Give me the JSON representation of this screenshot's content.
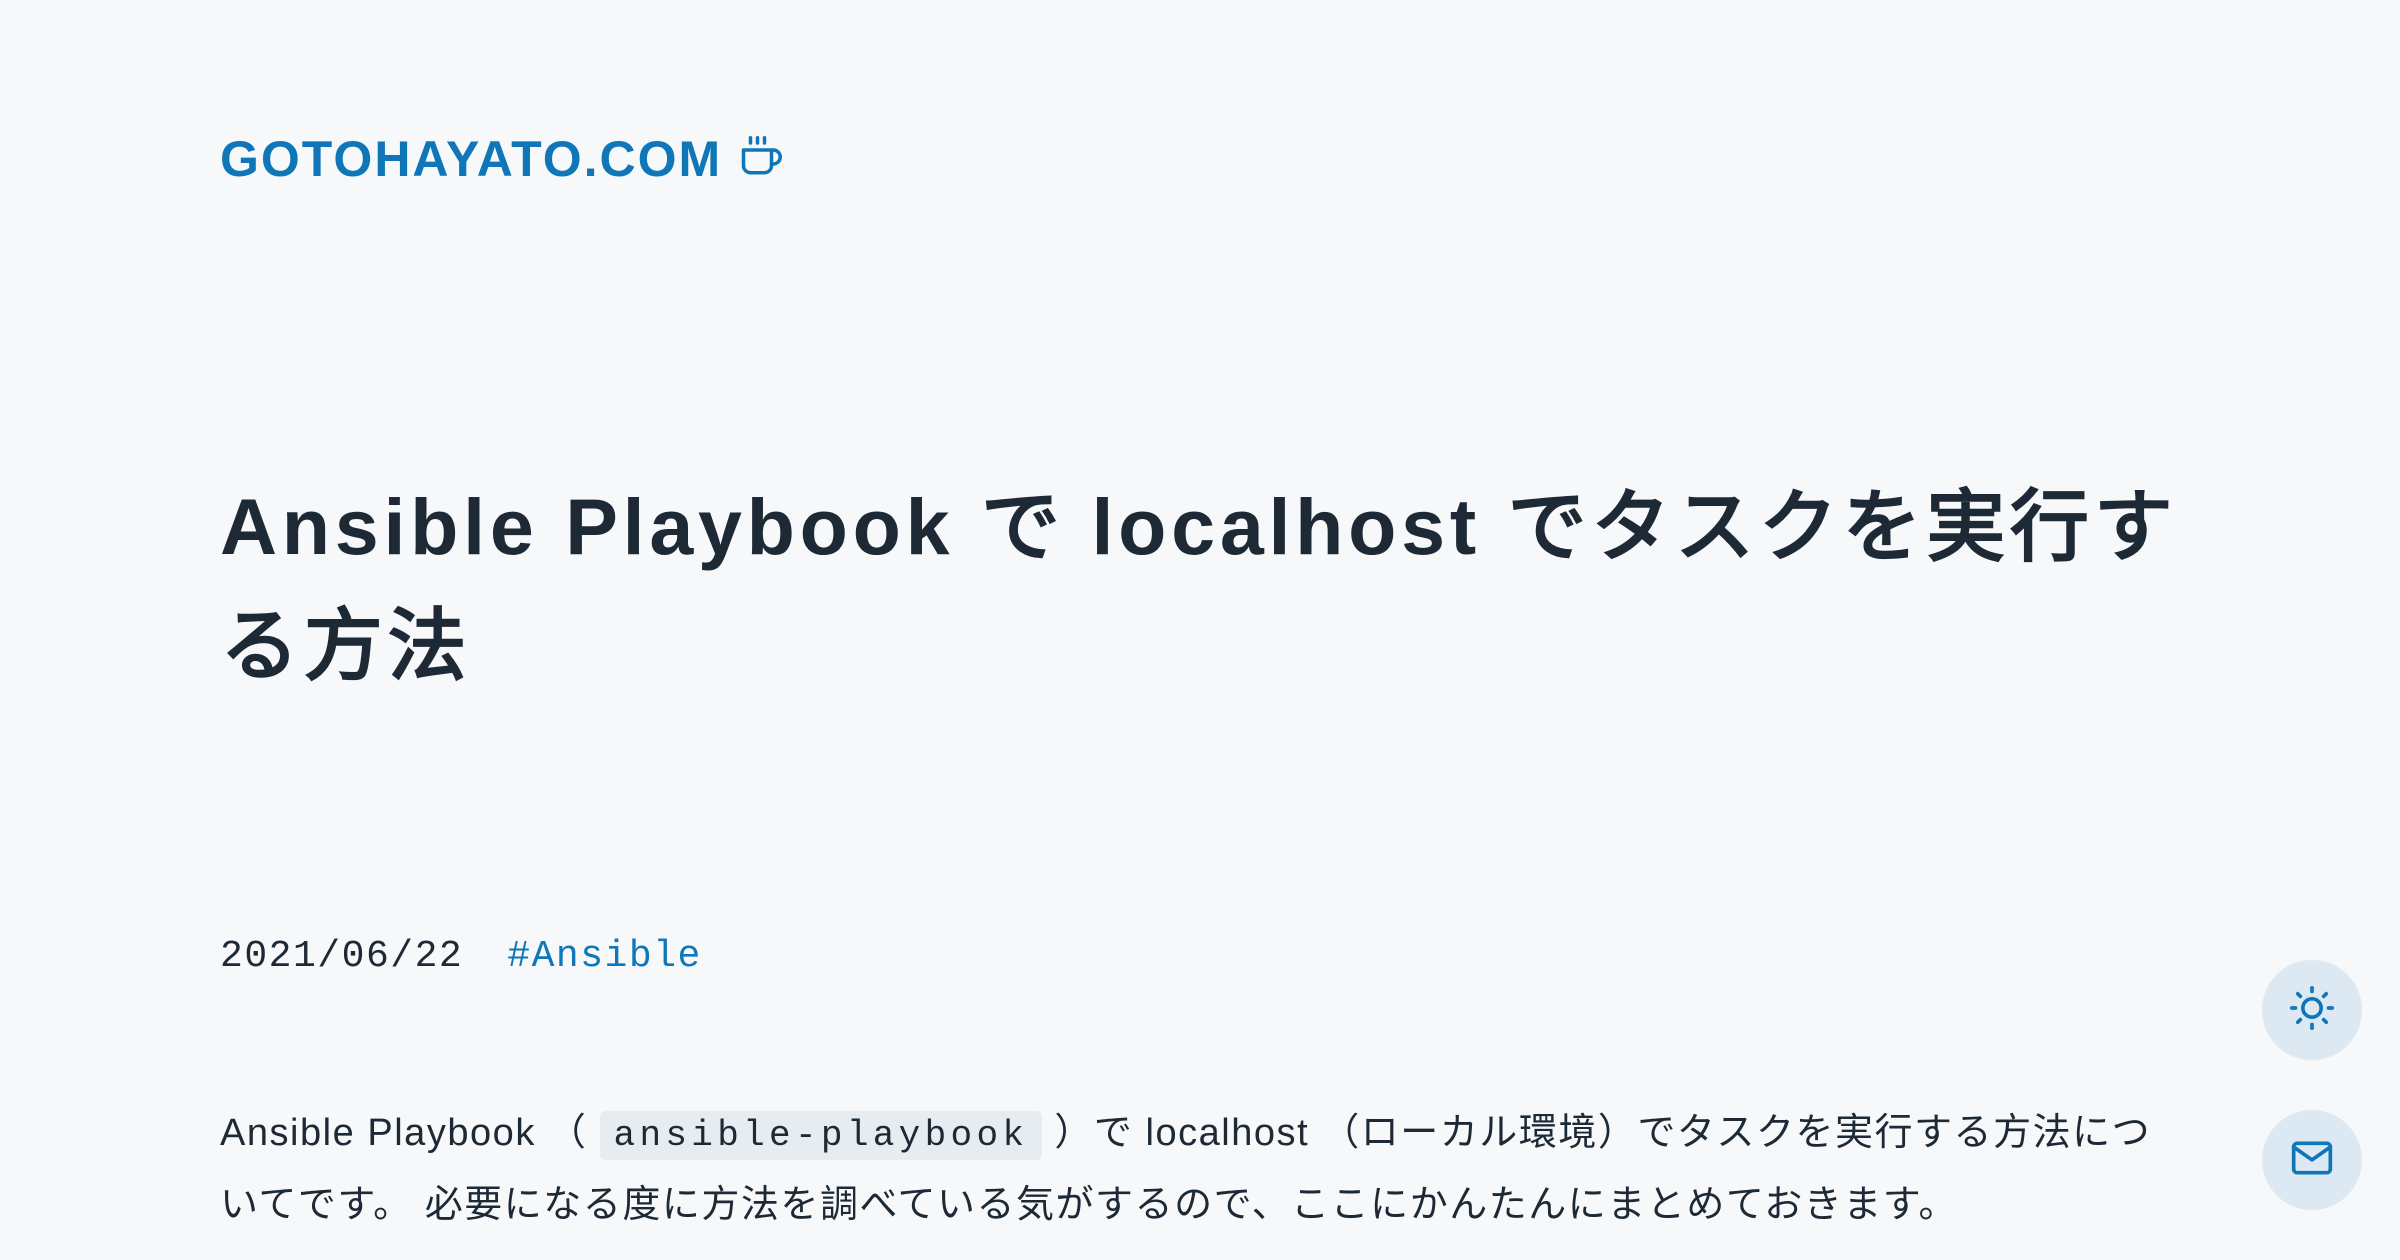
{
  "header": {
    "site_title": "GOTOHAYATO.COM"
  },
  "article": {
    "title": "Ansible Playbook で localhost でタスクを実行する方法",
    "date": "2021/06/22",
    "tag": "#Ansible",
    "body_prefix": "Ansible Playbook （ ",
    "inline_code": "ansible-playbook",
    "body_suffix": " ）で localhost （ローカル環境）でタスクを実行する方法についてです。 必要になる度に方法を調べている気がするので、ここにかんたんにまとめておきます。"
  }
}
